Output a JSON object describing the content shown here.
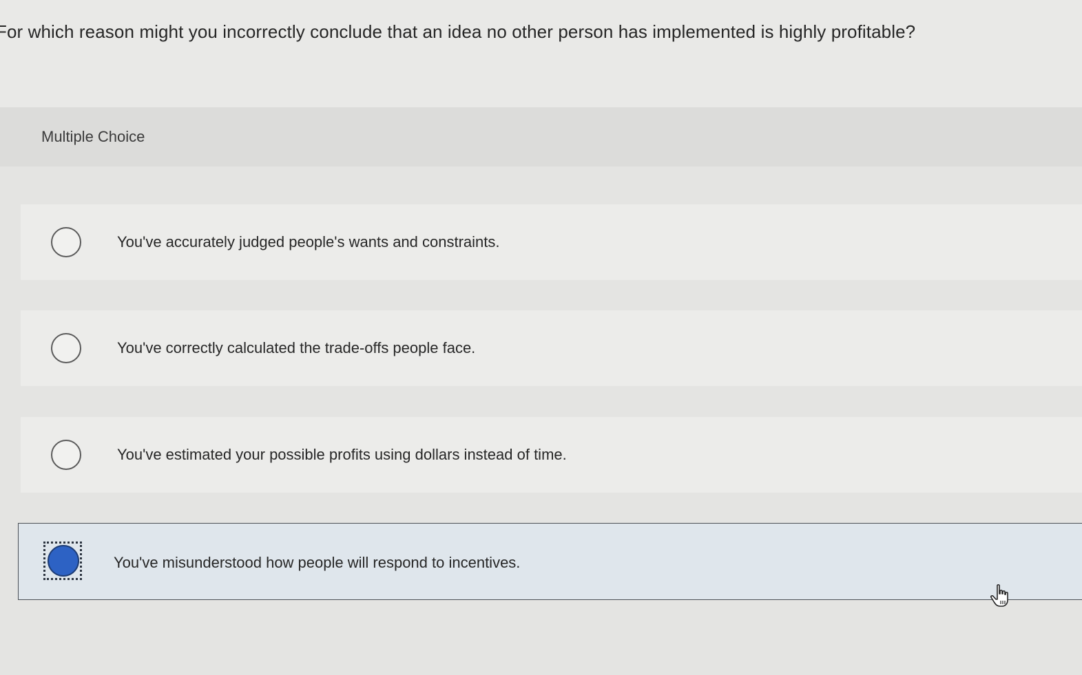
{
  "question": {
    "text": "For which reason might you incorrectly conclude that an idea no other person has implemented is highly profitable?"
  },
  "section": {
    "label": "Multiple Choice"
  },
  "options": [
    {
      "text": "You've accurately judged people's wants and constraints.",
      "selected": false
    },
    {
      "text": "You've correctly calculated the trade-offs people face.",
      "selected": false
    },
    {
      "text": "You've estimated your possible profits using dollars instead of time.",
      "selected": false
    },
    {
      "text": "You've misunderstood how people will respond to incentives.",
      "selected": true
    }
  ],
  "colors": {
    "selected_radio": "#2d62c4",
    "selected_background": "#dfe6ec"
  },
  "icons": {
    "cursor": "hand-pointer-icon"
  }
}
